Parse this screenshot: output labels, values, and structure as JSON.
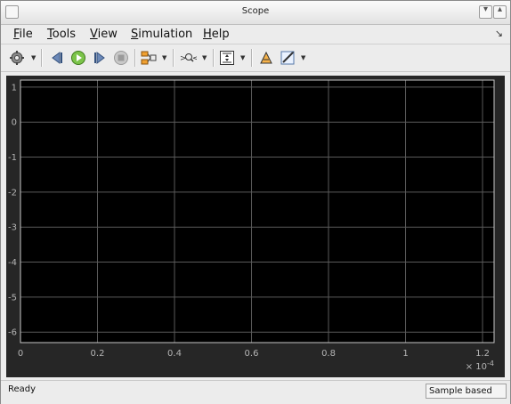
{
  "window": {
    "title": "Scope"
  },
  "menu": [
    {
      "underline": "F",
      "rest": "ile"
    },
    {
      "underline": "T",
      "rest": "ools"
    },
    {
      "underline": "V",
      "rest": "iew"
    },
    {
      "underline": "S",
      "rest": "imulation"
    },
    {
      "underline": "H",
      "rest": "elp"
    }
  ],
  "toolbar": {
    "icons": [
      "gear-icon",
      "step-back-icon",
      "run-icon",
      "step-forward-icon",
      "stop-icon",
      "signal-selector-icon",
      "zoom-icon",
      "autoscale-icon",
      "highlight-icon",
      "measurement-icon"
    ]
  },
  "status": {
    "left": "Ready",
    "right": "Sample based"
  },
  "colors": {
    "plot_background": "#000000",
    "panel": "#262626",
    "grid": "#5a5a5a",
    "axis_text": "#b4b4b4"
  },
  "chart_data": {
    "type": "line",
    "series": [],
    "xlim": [
      0,
      0.000123
    ],
    "ylim": [
      -6.3,
      1.2
    ],
    "xticks": [
      0,
      0.2,
      0.4,
      0.6,
      0.8,
      1,
      1.2
    ],
    "yticks": [
      1,
      0,
      -1,
      -2,
      -3,
      -4,
      -5,
      -6
    ],
    "xtick_labels": [
      "0",
      "0.2",
      "0.4",
      "0.6",
      "0.8",
      "1",
      "1.2"
    ],
    "ytick_labels": [
      "1",
      "0",
      "-1",
      "-2",
      "-3",
      "-4",
      "-5",
      "-6"
    ],
    "x_exponent": {
      "base": "× 10",
      "power": "-4"
    },
    "grid": true
  }
}
